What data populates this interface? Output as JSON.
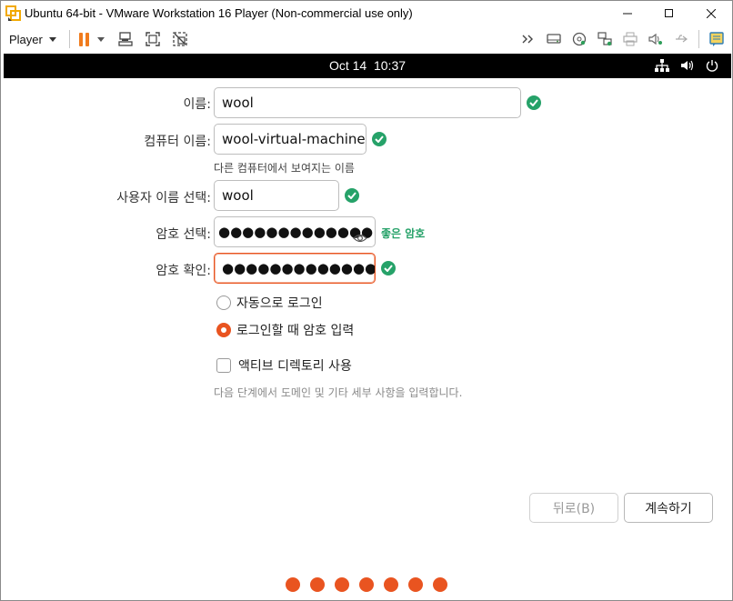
{
  "window": {
    "title": "Ubuntu 64-bit - VMware Workstation 16 Player (Non-commercial use only)",
    "controls": {
      "minimize": "—",
      "maximize": "☐",
      "close": "✕"
    }
  },
  "toolbar": {
    "player_label": "Player",
    "left_icons": [
      "pause-icon",
      "send-ctrl-alt-del-icon",
      "fullscreen-icon",
      "unity-icon"
    ],
    "right_icons": [
      "more-devices-icon",
      "hard-disk-icon",
      "cd-dvd-icon",
      "network-adapter-icon",
      "printer-icon",
      "sound-card-icon",
      "usb-icon",
      "message-log-icon"
    ]
  },
  "topbar": {
    "date": "Oct 14",
    "time": "10:37",
    "icons": [
      "network-icon",
      "volume-icon",
      "power-icon"
    ]
  },
  "form": {
    "name": {
      "label": "이름:",
      "value": "wool"
    },
    "computer_name": {
      "label": "컴퓨터 이름:",
      "value": "wool-virtual-machine",
      "hint": "다른 컴퓨터에서 보여지는 이름"
    },
    "username": {
      "label": "사용자 이름 선택:",
      "value": "wool"
    },
    "password": {
      "label": "암호 선택:",
      "value": "●●●●●●●●●●●●●",
      "strength": "좋은 암호"
    },
    "password_confirm": {
      "label": "암호 확인:",
      "value": "●●●●●●●●●●●●●"
    },
    "login_options": [
      {
        "label": "자동으로 로그인",
        "selected": false
      },
      {
        "label": "로그인할 때 암호 입력",
        "selected": true
      }
    ],
    "active_directory": {
      "label": "액티브 디렉토리 사용",
      "checked": false,
      "note": "다음 단계에서 도메인 및 기타 세부 사항을 입력합니다."
    }
  },
  "buttons": {
    "back": "뒤로(B)",
    "continue": "계속하기"
  },
  "progress": {
    "total_steps": 7
  },
  "colors": {
    "accent": "#e95420",
    "valid": "#26a269",
    "pause": "#f07b1d"
  }
}
